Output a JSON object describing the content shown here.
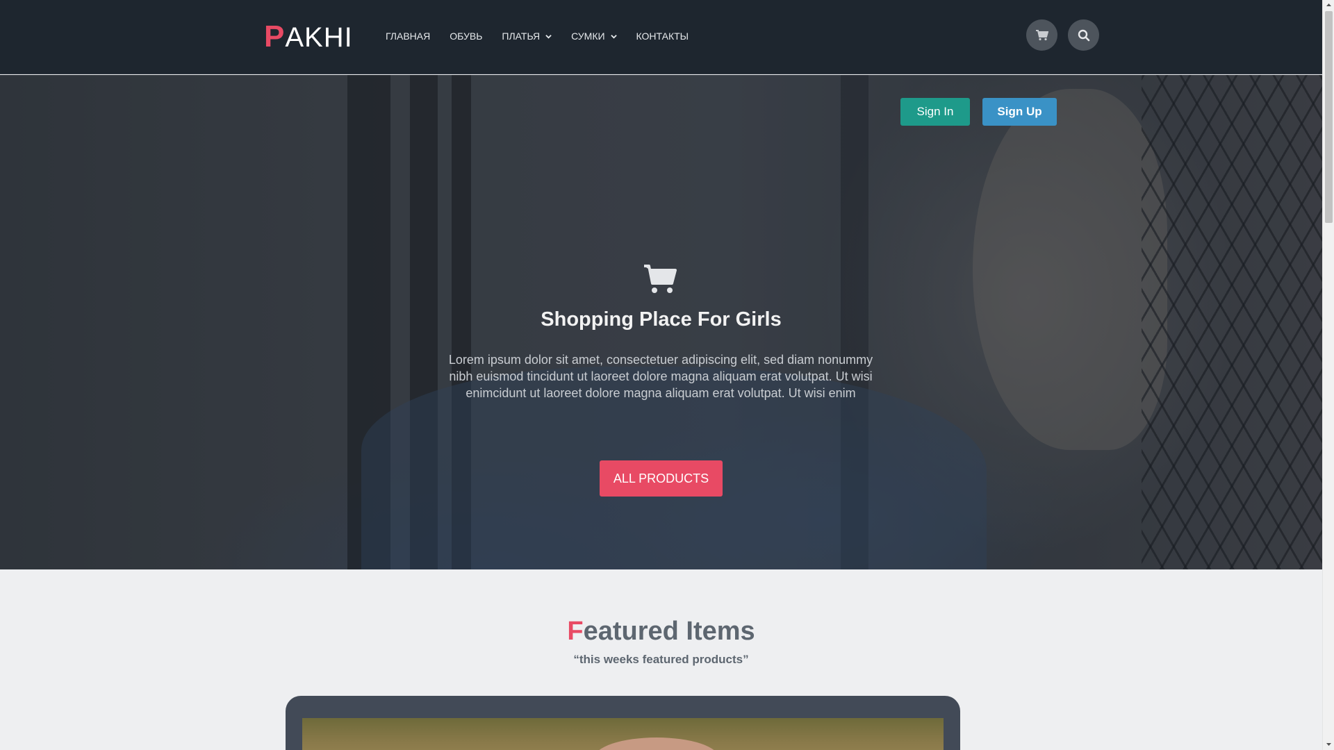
{
  "header": {
    "logo_first": "P",
    "logo_rest": "AKHI",
    "nav": [
      {
        "label": "ГЛАВНАЯ",
        "dropdown": false
      },
      {
        "label": "ОБУВЬ",
        "dropdown": false
      },
      {
        "label": "ПЛАТЬЯ",
        "dropdown": true
      },
      {
        "label": "СУМКИ",
        "dropdown": true
      },
      {
        "label": "КОНТАКТЫ",
        "dropdown": false
      }
    ],
    "icons": [
      "cart-icon",
      "search-icon"
    ]
  },
  "hero": {
    "sign_in": "Sign In",
    "sign_up": "Sign Up",
    "icon": "cart-icon",
    "title": "Shopping Place For Girls",
    "text": "Lorem ipsum dolor sit amet, consectetuer adipiscing elit, sed diam nonummy nibh euismod tincidunt ut laoreet dolore magna aliquam erat volutpat. Ut wisi enimcidunt ut laoreet dolore magna aliquam erat volutpat. Ut wisi enim",
    "cta": "ALL PRODUCTS"
  },
  "featured": {
    "title_first": "F",
    "title_rest": "eatured Items",
    "subtitle": "“this weeks featured products”"
  },
  "colors": {
    "header_bg": "#1e262f",
    "accent": "#e84a64",
    "signin_bg": "#1e9a8a",
    "signup_bg": "#3a92c6",
    "page_bg": "#eeeff1",
    "card_bg": "#424a57"
  }
}
